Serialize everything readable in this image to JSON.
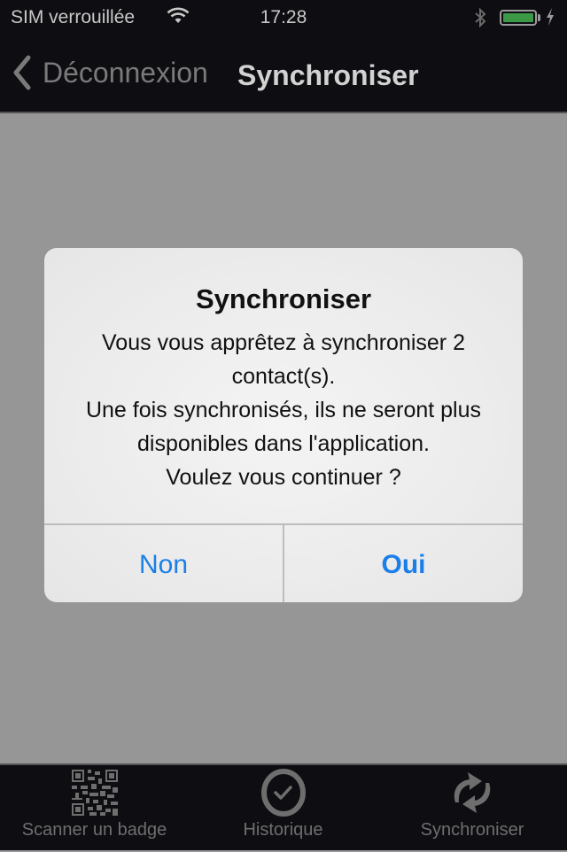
{
  "status_bar": {
    "carrier": "SIM verrouillée",
    "time": "17:28",
    "battery_level": 1.0,
    "battery_color": "#3c9a46",
    "icons": [
      "wifi-icon",
      "bluetooth-icon",
      "battery-icon",
      "charging-bolt-icon"
    ]
  },
  "nav": {
    "back_label": "Déconnexion",
    "title": "Synchroniser"
  },
  "alert": {
    "title": "Synchroniser",
    "message": "Vous vous apprêtez à synchroniser 2 contact(s).\n Une fois synchronisés, ils ne seront plus disponibles dans l'application.\nVoulez vous continuer ?",
    "cancel_label": "Non",
    "confirm_label": "Oui",
    "button_color": "#1a7fe8"
  },
  "tabbar": {
    "items": [
      {
        "label": "Scanner un badge",
        "icon": "qr-code-icon"
      },
      {
        "label": "Historique",
        "icon": "clock-check-icon"
      },
      {
        "label": "Synchroniser",
        "icon": "sync-icon"
      }
    ]
  }
}
